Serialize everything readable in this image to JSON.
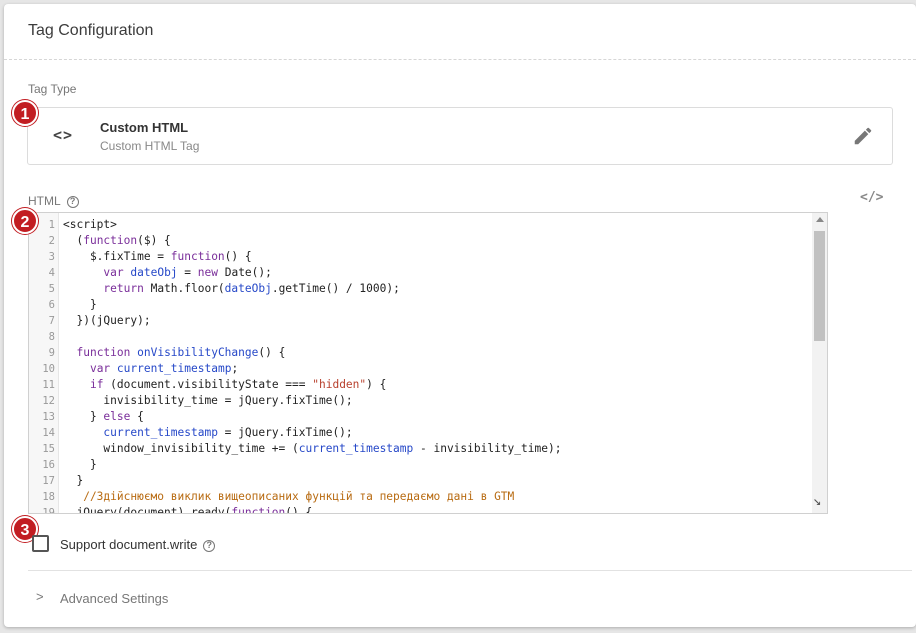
{
  "header": {
    "title": "Tag Configuration"
  },
  "tag_type": {
    "label": "Tag Type",
    "icon": "code-icon",
    "icon_glyph": "<>",
    "title": "Custom HTML",
    "subtitle": "Custom HTML Tag",
    "edit_icon": "pencil-icon"
  },
  "html_section": {
    "label": "HTML",
    "help_icon": "?",
    "toggle_glyph": "</>"
  },
  "editor": {
    "lines": [
      {
        "n": "1",
        "code": "<script>"
      },
      {
        "n": "2",
        "code": "  (function($) {"
      },
      {
        "n": "3",
        "code": "    $.fixTime = function() {"
      },
      {
        "n": "4",
        "code": "      var dateObj = new Date();"
      },
      {
        "n": "5",
        "code": "      return Math.floor(dateObj.getTime() / 1000);"
      },
      {
        "n": "6",
        "code": "    }"
      },
      {
        "n": "7",
        "code": "  })(jQuery);"
      },
      {
        "n": "8",
        "code": ""
      },
      {
        "n": "9",
        "code": "  function onVisibilityChange() {"
      },
      {
        "n": "10",
        "code": "    var current_timestamp;"
      },
      {
        "n": "11",
        "code": "    if (document.visibilityState === \"hidden\") {"
      },
      {
        "n": "12",
        "code": "      invisibility_time = jQuery.fixTime();"
      },
      {
        "n": "13",
        "code": "    } else {"
      },
      {
        "n": "14",
        "code": "      current_timestamp = jQuery.fixTime();"
      },
      {
        "n": "15",
        "code": "      window_invisibility_time += (current_timestamp - invisibility_time);"
      },
      {
        "n": "16",
        "code": "    }"
      },
      {
        "n": "17",
        "code": "  }"
      },
      {
        "n": "18",
        "code": "   //Здійснюємо виклик вищеописаних функцій та передаємо дані в GTM"
      },
      {
        "n": "19",
        "code": "  jQuery(document).ready(function() {"
      }
    ]
  },
  "badges": [
    "1",
    "2",
    "3"
  ],
  "support_document_write": {
    "label": "Support document.write",
    "checked": false,
    "help_icon": "?"
  },
  "advanced": {
    "chevron": ">",
    "label": "Advanced Settings"
  },
  "colors": {
    "badge": "#c21d22",
    "keyword": "#7a2e9a",
    "function": "#2648c8",
    "string": "#b8402d",
    "comment": "#b86b12"
  }
}
